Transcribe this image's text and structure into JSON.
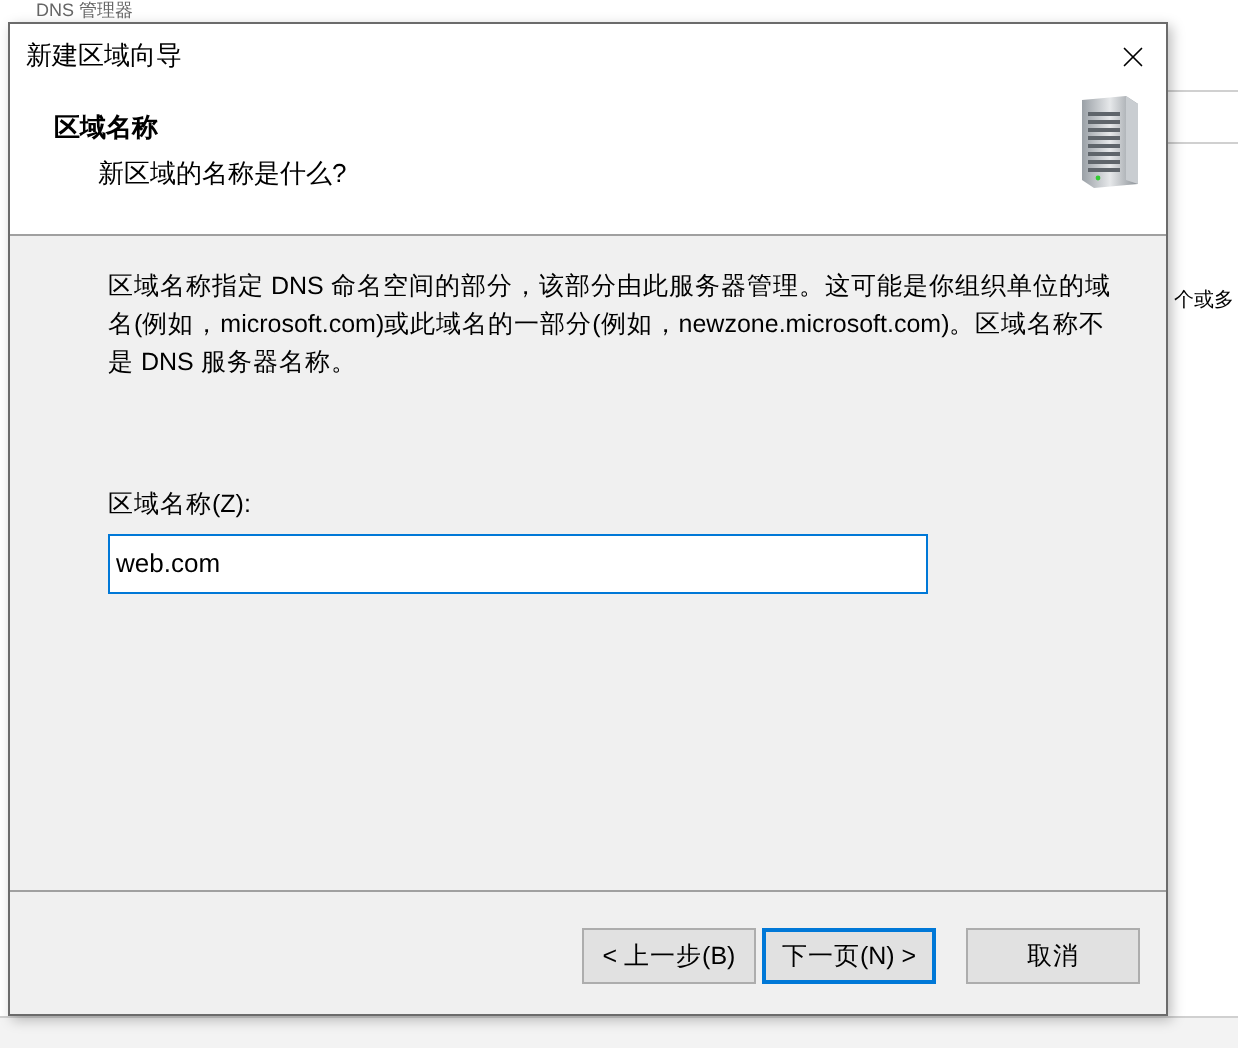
{
  "background_window": {
    "title": "DNS 管理器",
    "text_fragment": "个或多"
  },
  "dialog": {
    "title": "新建区域向导",
    "header": {
      "title": "区域名称",
      "subtitle": "新区域的名称是什么?"
    },
    "description": "区域名称指定 DNS 命名空间的部分，该部分由此服务器管理。这可能是你组织单位的域名(例如，microsoft.com)或此域名的一部分(例如，newzone.microsoft.com)。区域名称不是 DNS 服务器名称。",
    "field": {
      "label": "区域名称(Z):",
      "value": "web.com"
    },
    "buttons": [
      {
        "label": "< 上一步(B)",
        "focused": false
      },
      {
        "label": "下一页(N) >",
        "focused": true
      },
      {
        "label": "取消",
        "focused": false
      }
    ]
  }
}
